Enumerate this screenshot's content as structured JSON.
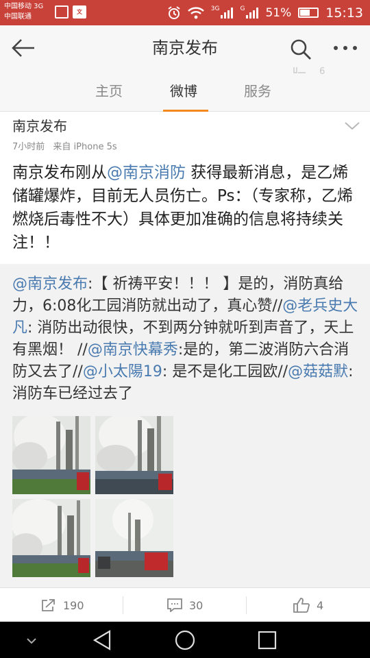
{
  "status_bar": {
    "carrier_1": "中国移动 3G",
    "carrier_2": "中国联通",
    "notif_badge": "文",
    "network_1": "3G",
    "network_2": "G",
    "battery": "51%",
    "time": "15:13"
  },
  "header": {
    "title": "南京发布"
  },
  "tabs": [
    {
      "label": "主页"
    },
    {
      "label": "微博"
    },
    {
      "label": "服务"
    }
  ],
  "active_tab_color": "#f28a1d",
  "ghost_count": "6",
  "post": {
    "author": "南京发布",
    "time": "7小时前",
    "source": "来自 iPhone 5s",
    "text_before": "南京发布刚从",
    "mention": "@南京消防",
    "text_after": " 获得最新消息，是乙烯储罐爆炸，目前无人员伤亡。Ps：（专家称，乙烯燃烧后毒性不大）具体更加准确的信息将持续关注！！"
  },
  "repost": {
    "m1": "@南京发布",
    "t1": ":【 祈祷平安！！！ 】是的，消防真给力，6:08化工园消防就出动了，真心赞//",
    "m2": "@老兵史大凡",
    "t2": ": 消防出动很快，不到两分钟就听到声音了，天上有黑烟！ //",
    "m3": "@南京快幕秀",
    "t3": ":是的，第二波消防六合消防又去了//",
    "m4": "@小太陽19",
    "t4": ": 是不是化工园欧//",
    "m5": "@菇菇默",
    "t5": ":消防车已经过去了"
  },
  "mention_color": "#4a7bb0",
  "actions": {
    "repost_count": "190",
    "comment_count": "30",
    "like_count": "4"
  },
  "brand_color": "#c8423a"
}
